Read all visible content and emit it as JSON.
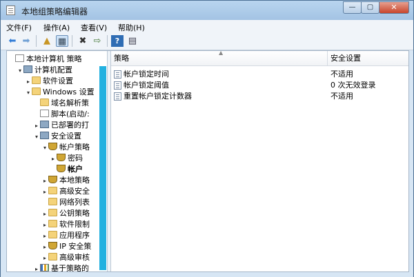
{
  "window": {
    "title": "本地组策略编辑器"
  },
  "menu": [
    "文件(F)",
    "操作(A)",
    "查看(V)",
    "帮助(H)"
  ],
  "toolbar": {
    "icons": [
      "back-arrow-icon",
      "forward-arrow-icon",
      "up-folder-icon",
      "show-hide-tree-icon",
      "delete-icon",
      "export-list-icon",
      "help-icon",
      "properties-icon"
    ]
  },
  "tree": [
    {
      "label": "本地计算机 策略",
      "icon": "doc",
      "depth": 0,
      "arrow": ""
    },
    {
      "label": "计算机配置",
      "icon": "computer",
      "depth": 1,
      "arrow": "▾"
    },
    {
      "label": "软件设置",
      "icon": "folder",
      "depth": 2,
      "arrow": "▸"
    },
    {
      "label": "Windows 设置",
      "icon": "folder",
      "depth": 2,
      "arrow": "▾"
    },
    {
      "label": "域名解析策",
      "icon": "folder",
      "depth": 3,
      "arrow": ""
    },
    {
      "label": "脚本(启动/:",
      "icon": "doc",
      "depth": 3,
      "arrow": ""
    },
    {
      "label": "已部署的打",
      "icon": "computer",
      "depth": 3,
      "arrow": "▸"
    },
    {
      "label": "安全设置",
      "icon": "computer",
      "depth": 3,
      "arrow": "▾"
    },
    {
      "label": "帐户策略",
      "icon": "shield",
      "depth": 4,
      "arrow": "▾"
    },
    {
      "label": "密码",
      "icon": "shield",
      "depth": 5,
      "arrow": "▸"
    },
    {
      "label": "帐户",
      "icon": "shield",
      "depth": 5,
      "arrow": "",
      "bold": true
    },
    {
      "label": "本地策略",
      "icon": "shield",
      "depth": 4,
      "arrow": "▸"
    },
    {
      "label": "高级安全",
      "icon": "folder",
      "depth": 4,
      "arrow": "▸"
    },
    {
      "label": "网络列表",
      "icon": "folder",
      "depth": 4,
      "arrow": ""
    },
    {
      "label": "公钥策略",
      "icon": "folder",
      "depth": 4,
      "arrow": "▸"
    },
    {
      "label": "软件限制",
      "icon": "folder",
      "depth": 4,
      "arrow": "▸"
    },
    {
      "label": "应用程序",
      "icon": "folder",
      "depth": 4,
      "arrow": "▸"
    },
    {
      "label": "IP 安全策",
      "icon": "shield",
      "depth": 4,
      "arrow": "▸"
    },
    {
      "label": "高级审核",
      "icon": "folder",
      "depth": 4,
      "arrow": "▸"
    },
    {
      "label": "基于策略的",
      "icon": "chart",
      "depth": 3,
      "arrow": "▸"
    }
  ],
  "list": {
    "columns": [
      "策略",
      "安全设置"
    ],
    "rows": [
      {
        "name": "帐户锁定时间",
        "setting": "不适用"
      },
      {
        "name": "帐户锁定阈值",
        "setting": "0 次无效登录"
      },
      {
        "name": "重置帐户锁定计数器",
        "setting": "不适用"
      }
    ]
  }
}
